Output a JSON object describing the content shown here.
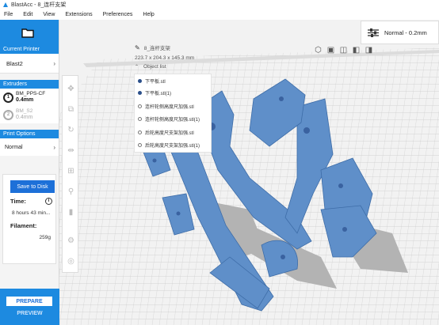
{
  "window": {
    "title": "BlastAcc - 8_连杆支架"
  },
  "menu": [
    "File",
    "Edit",
    "View",
    "Extensions",
    "Preferences",
    "Help"
  ],
  "sidebar": {
    "current_printer_label": "Current Printer",
    "printer": "Blast2",
    "extruders_label": "Extruders",
    "extruders": [
      {
        "index": "1",
        "material": "BM_PPS-CF",
        "size": "0.4mm",
        "active": true
      },
      {
        "index": "2",
        "material": "BM_S2",
        "size": "0.4mm",
        "active": false
      }
    ],
    "print_options_label": "Print Options",
    "print_mode": "Normal",
    "save_button": "Save to Disk",
    "time_label": "Time:",
    "time_value": "8 hours 43 min...",
    "filament_label": "Filament:",
    "filament_value": "259g",
    "prepare_button": "PREPARE",
    "preview_label": "PREVIEW"
  },
  "model": {
    "name": "8_连杆支架",
    "dimensions": "223.7 x 204.3 x 145.3 mm",
    "object_list_label": "Object list",
    "objects": [
      {
        "name": "下平板.stl",
        "marker": "filled"
      },
      {
        "name": "下平板.stl(1)",
        "marker": "filled"
      },
      {
        "name": "连杆轮侧高度尺加强.stl",
        "marker": "ring"
      },
      {
        "name": "连杆轮侧高度尺加强.stl(1)",
        "marker": "ring"
      },
      {
        "name": "后轮高度尺支架加强.stl",
        "marker": "ring"
      },
      {
        "name": "后轮高度尺支架加强.stl(1)",
        "marker": "ring"
      }
    ]
  },
  "view_icons": [
    "view-3d-icon",
    "view-front-icon",
    "view-top-icon",
    "view-left-icon",
    "view-right-icon"
  ],
  "layer_profile": "Normal - 0.2mm",
  "colors": {
    "accent": "#1d8ae0",
    "button": "#1d70d8",
    "model": "#5f8fc9",
    "shadow": "#b9b9b9"
  }
}
